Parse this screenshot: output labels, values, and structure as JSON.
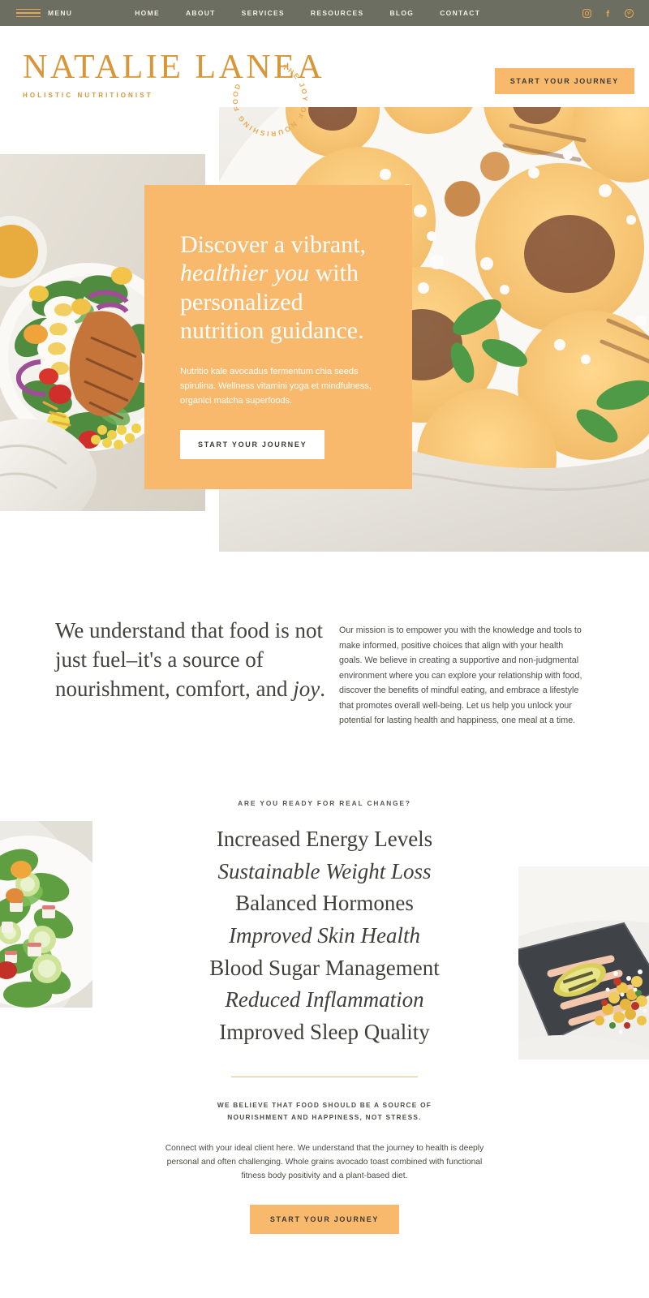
{
  "nav": {
    "menu_label": "MENU",
    "hamburger_icon": "hamburger-icon",
    "links": [
      {
        "label": "HOME"
      },
      {
        "label": "ABOUT"
      },
      {
        "label": "SERVICES"
      },
      {
        "label": "RESOURCES"
      },
      {
        "label": "BLOG"
      },
      {
        "label": "CONTACT"
      }
    ],
    "socials": [
      {
        "icon": "instagram-icon"
      },
      {
        "icon": "facebook-icon"
      },
      {
        "icon": "pinterest-icon"
      }
    ],
    "bar_color": "#6b6e61",
    "accent_color": "#e8a74f"
  },
  "brand": {
    "name": "NATALIE LANEA",
    "tagline": "HOLISTIC NUTRITIONIST",
    "badge_text": "THE JOY OF NOURISHING FOOD",
    "color": "#d79637"
  },
  "header_cta": {
    "label": "START YOUR JOURNEY"
  },
  "hero": {
    "heading_line1": "Discover a vibrant,",
    "heading_italic": "healthier you",
    "heading_after_italic": " with",
    "heading_line3": "personalized",
    "heading_line4": "nutrition guidance.",
    "paragraph": "Nutritio kale avocadus fermentum chia seeds spirulina. Wellness vitamini yoga et mindfulness, organici matcha superfoods.",
    "button_label": "START YOUR JOURNEY",
    "card_color": "#f9b96d",
    "image_main": "grilled-peaches-feta-mint-photo",
    "image_left": "chicken-salad-bowl-photo"
  },
  "mission": {
    "heading_part1": "We understand that food is not just fuel–it's a source of nourishment, comfort, and ",
    "heading_italic": "joy",
    "heading_part2": ".",
    "paragraph": "Our mission is to empower you with the knowledge and tools to make informed, positive choices that align with your health goals. We believe in creating a supportive and non-judgmental environment where you can explore your relationship with food, discover the benefits of mindful eating, and embrace a lifestyle that promotes overall well-being. Let us help you unlock your potential for lasting health and happiness, one meal at a time."
  },
  "benefits": {
    "eyebrow": "ARE YOU READY FOR REAL CHANGE?",
    "items": [
      {
        "label": "Increased Energy Levels",
        "style": "regular"
      },
      {
        "label": "Sustainable Weight Loss",
        "style": "italic"
      },
      {
        "label": "Balanced Hormones",
        "style": "regular"
      },
      {
        "label": "Improved Skin Health",
        "style": "italic"
      },
      {
        "label": "Blood Sugar Management",
        "style": "regular"
      },
      {
        "label": "Reduced Inflammation",
        "style": "italic"
      },
      {
        "label": "Improved Sleep Quality",
        "style": "regular"
      }
    ],
    "image_left": "green-salad-cucumber-apple-photo",
    "image_right": "slate-board-corn-salad-photo",
    "divider_color": "#f0b878"
  },
  "closing": {
    "caps_line1": "WE BELIEVE THAT FOOD SHOULD BE A SOURCE OF",
    "caps_line2": "NOURISHMENT AND HAPPINESS, NOT STRESS.",
    "paragraph": "Connect with your ideal client here. We understand that the journey to health is deeply personal and often challenging. Whole grains avocado toast combined with functional fitness body positivity and a plant-based diet.",
    "button_label": "START YOUR JOURNEY"
  }
}
